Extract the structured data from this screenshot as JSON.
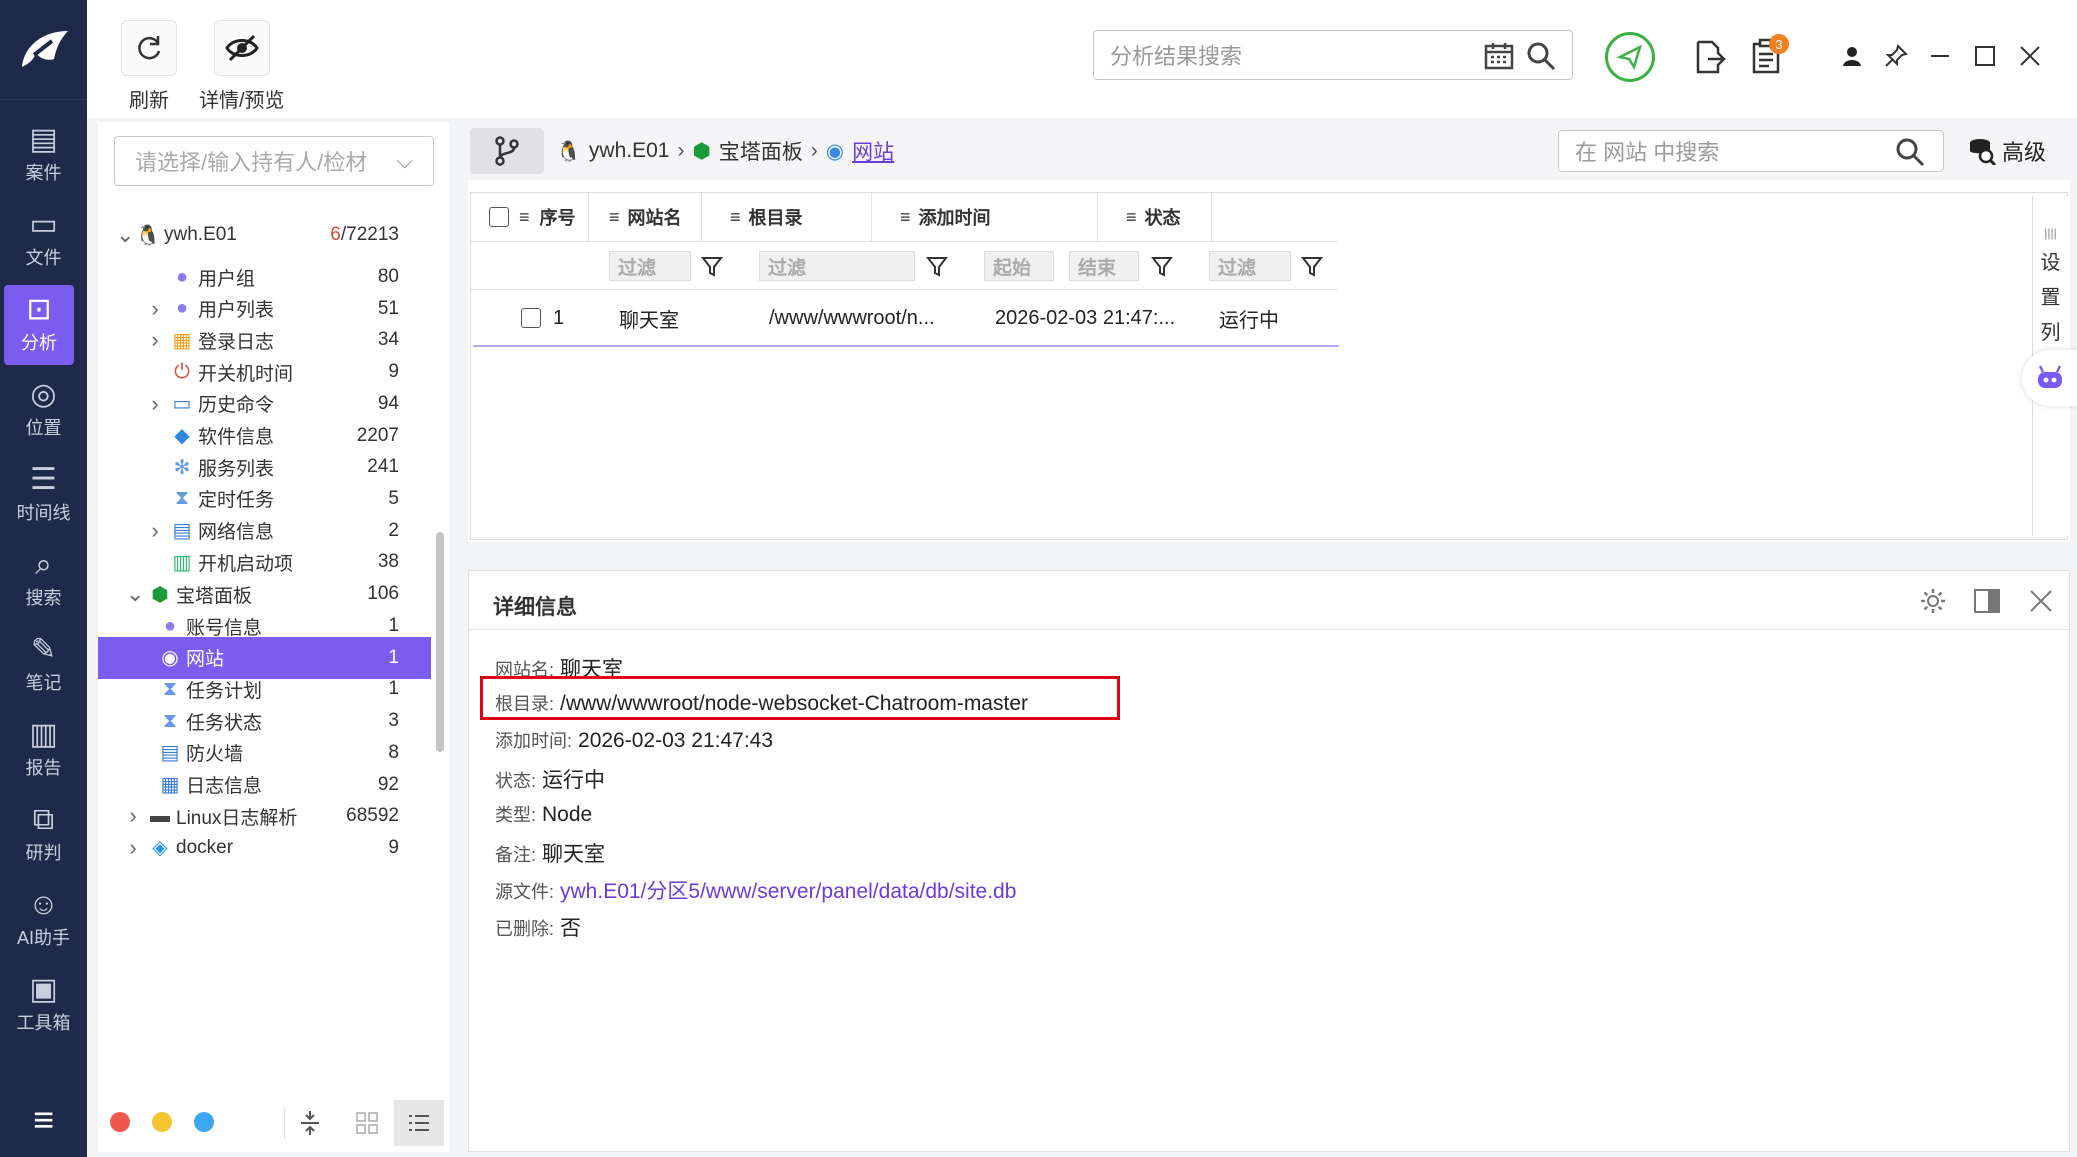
{
  "toolbar": {
    "refresh_label": "刷新",
    "detail_preview_label": "详情/预览",
    "search_placeholder": "分析结果搜索",
    "badge_count": "3"
  },
  "rail": {
    "items": [
      "案件",
      "文件",
      "分析",
      "位置",
      "时间线",
      "搜索",
      "笔记",
      "报告",
      "研判",
      "AI助手",
      "工具箱"
    ],
    "active": "分析"
  },
  "tree": {
    "combo_placeholder": "请选择/输入持有人/检材",
    "root": {
      "label": "ywh.E01",
      "count_red": "6",
      "count_total": "/72213"
    },
    "items": [
      {
        "label": "用户组",
        "count": "80",
        "expand": false,
        "icon": "user-group-icon"
      },
      {
        "label": "用户列表",
        "count": "51",
        "expand": true,
        "icon": "user-list-icon"
      },
      {
        "label": "登录日志",
        "count": "34",
        "expand": true,
        "icon": "login-log-icon"
      },
      {
        "label": "开关机时间",
        "count": "9",
        "expand": false,
        "icon": "power-icon"
      },
      {
        "label": "历史命令",
        "count": "94",
        "expand": true,
        "icon": "terminal-icon"
      },
      {
        "label": "软件信息",
        "count": "2207",
        "expand": false,
        "icon": "cube-icon"
      },
      {
        "label": "服务列表",
        "count": "241",
        "expand": false,
        "icon": "service-icon"
      },
      {
        "label": "定时任务",
        "count": "5",
        "expand": false,
        "icon": "hourglass-icon"
      },
      {
        "label": "网络信息",
        "count": "2",
        "expand": true,
        "icon": "network-icon"
      },
      {
        "label": "开机启动项",
        "count": "38",
        "expand": false,
        "icon": "startup-icon"
      }
    ],
    "bt_panel": {
      "label": "宝塔面板",
      "count": "106"
    },
    "bt_items": [
      {
        "label": "账号信息",
        "count": "1",
        "icon": "account-icon"
      },
      {
        "label": "网站",
        "count": "1",
        "icon": "website-icon",
        "selected": true
      },
      {
        "label": "任务计划",
        "count": "1",
        "icon": "hourglass-icon"
      },
      {
        "label": "任务状态",
        "count": "3",
        "icon": "hourglass-icon"
      },
      {
        "label": "防火墙",
        "count": "8",
        "icon": "firewall-icon"
      },
      {
        "label": "日志信息",
        "count": "92",
        "icon": "log-icon"
      }
    ],
    "others": [
      {
        "label": "Linux日志解析",
        "count": "68592",
        "icon": "log-file-icon"
      },
      {
        "label": "docker",
        "count": "9",
        "icon": "docker-icon"
      }
    ]
  },
  "breadcrumb": {
    "root": "ywh.E01",
    "panel": "宝塔面板",
    "current": "网站"
  },
  "main_search": {
    "placeholder": "在 网站 中搜索",
    "advanced_label": "高级"
  },
  "grid": {
    "columns": [
      "序号",
      "网站名",
      "根目录",
      "添加时间",
      "状态"
    ],
    "filter_text": "过滤",
    "date_start": "起始",
    "date_end": "结束",
    "rows": [
      {
        "index": "1",
        "name": "聊天室",
        "root": "/www/wwwroot/n...",
        "added": "2026-02-03 21:47:...",
        "status": "运行中"
      }
    ],
    "settings_col": [
      "设",
      "置",
      "列"
    ]
  },
  "detail": {
    "title": "详细信息",
    "fields": [
      {
        "k": "网站名:",
        "v": "聊天室"
      },
      {
        "k": "根目录:",
        "v": "/www/wwwroot/node-websocket-Chatroom-master"
      },
      {
        "k": "添加时间:",
        "v": "2026-02-03 21:47:43"
      },
      {
        "k": "状态:",
        "v": "运行中"
      },
      {
        "k": "类型:",
        "v": "Node"
      },
      {
        "k": "备注:",
        "v": "聊天室"
      },
      {
        "k": "源文件:",
        "v": "ywh.E01/分区5/www/server/panel/data/db/site.db"
      },
      {
        "k": "已删除:",
        "v": "否"
      }
    ]
  },
  "colors": {
    "accent": "#7a5cf0",
    "rail_bg": "#1f2a4a",
    "highlight_box": "#e3001b",
    "link": "#6a3cd8"
  }
}
